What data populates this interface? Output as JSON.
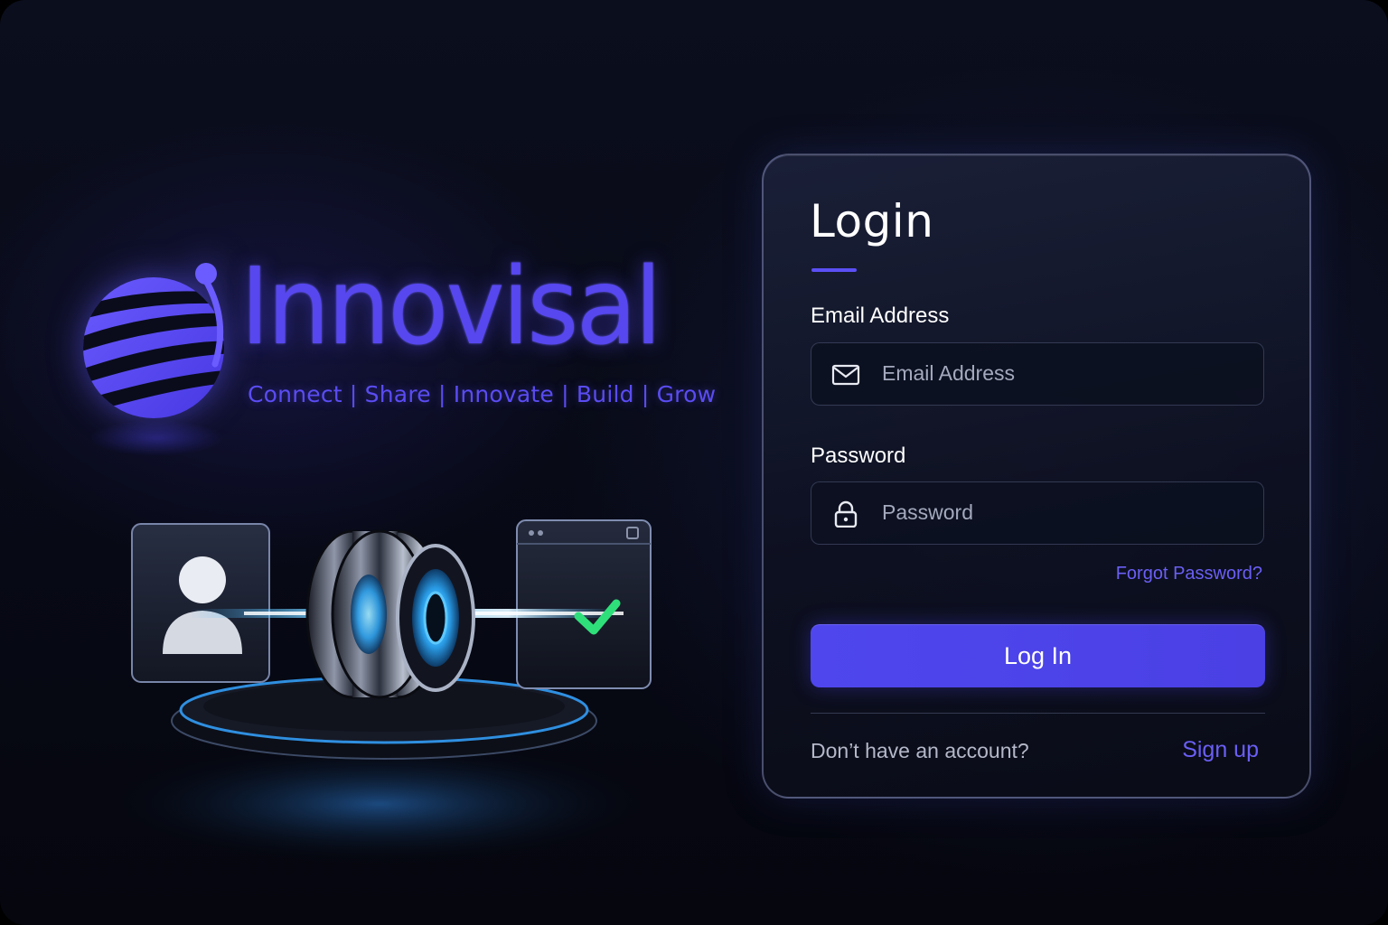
{
  "brand": {
    "name": "Innovisal",
    "tagline": "Connect | Share | Innovate | Build | Grow",
    "logo_icon": "striped-globe-icon",
    "accent_color": "#5747ef"
  },
  "illustration": {
    "user_card_icon": "user-avatar-icon",
    "lens_icon": "verification-lens-icon",
    "window_card_icon": "browser-window-icon",
    "check_icon": "checkmark-icon",
    "check_color": "#2fe07a",
    "beam_color": "#3fb4ff"
  },
  "login": {
    "title": "Login",
    "email": {
      "label": "Email Address",
      "placeholder": "Email Address",
      "value": "",
      "icon": "envelope-icon"
    },
    "password": {
      "label": "Password",
      "placeholder": "Password",
      "value": "",
      "icon": "lock-icon"
    },
    "forgot_password": "Forgot Password?",
    "submit_label": "Log In",
    "signup_prompt": "Don’t have an account?",
    "signup_link": "Sign up",
    "button_color": "#4f46ee",
    "link_color": "#6a5ff5"
  }
}
